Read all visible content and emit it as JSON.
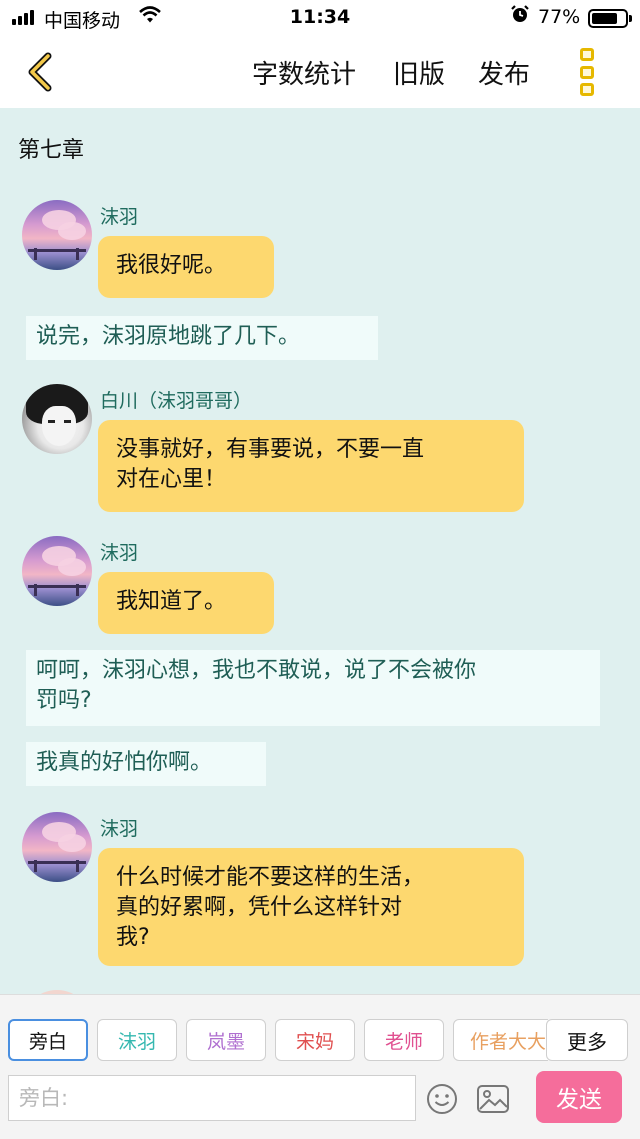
{
  "status_bar": {
    "carrier": "中国移动",
    "time": "11:34",
    "battery_percent": "77%",
    "battery_level": 0.77,
    "wifi_icon": "wifi-icon",
    "alarm_icon": "alarm-icon"
  },
  "nav": {
    "back_icon": "chevron-left-icon",
    "word_count_label": "字数统计",
    "old_version_label": "旧版",
    "publish_label": "发布",
    "more_icon": "more-vertical-icon",
    "accent_color": "#e6b800"
  },
  "content": {
    "chapter_title": "第七章",
    "messages": [
      {
        "type": "dialogue",
        "speaker": "沫羽",
        "lines": [
          "我很好呢。"
        ]
      },
      {
        "type": "narration",
        "lines": [
          "说完，沫羽原地跳了几下。"
        ]
      },
      {
        "type": "dialogue",
        "speaker": "白川（沫羽哥哥）",
        "lines": [
          "没事就好，有事要说，不要一直",
          "对在心里！"
        ]
      },
      {
        "type": "dialogue",
        "speaker": "沫羽",
        "lines": [
          "我知道了。"
        ]
      },
      {
        "type": "narration",
        "lines": [
          "呵呵，沫羽心想，我也不敢说，说了不会被你",
          "罚吗?"
        ]
      },
      {
        "type": "narration",
        "lines": [
          "我真的好怕你啊。"
        ]
      },
      {
        "type": "dialogue",
        "speaker": "沫羽",
        "lines": [
          "什么时候才能不要这样的生活，",
          "真的好累啊，凭什么这样针对",
          "我?"
        ]
      }
    ]
  },
  "composer": {
    "roles": [
      {
        "label": "旁白",
        "color": "#111111",
        "active": true
      },
      {
        "label": "沫羽",
        "color": "#35b8b0",
        "active": false
      },
      {
        "label": "岚墨",
        "color": "#b070d0",
        "active": false
      },
      {
        "label": "宋妈",
        "color": "#e05050",
        "active": false
      },
      {
        "label": "老师",
        "color": "#e05090",
        "active": false
      },
      {
        "label": "作者大大",
        "color": "#e8a060",
        "active": false
      }
    ],
    "more_label": "更多",
    "input_placeholder": "旁白:",
    "emoji_icon": "emoji-icon",
    "image_icon": "image-icon",
    "send_label": "发送",
    "send_color": "#f56d9b"
  }
}
